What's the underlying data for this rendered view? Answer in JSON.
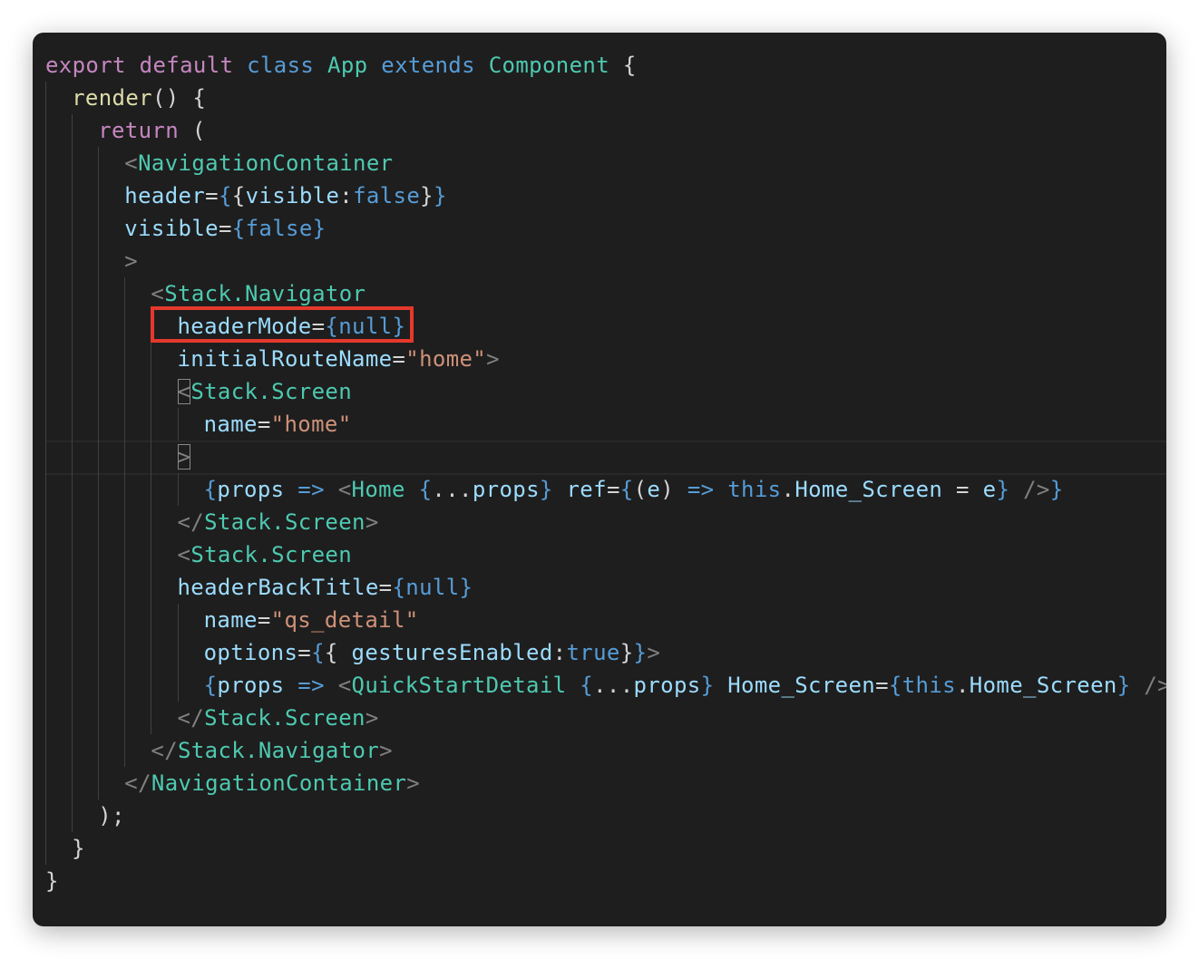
{
  "editor": {
    "theme_colors": {
      "background": "#1e1e1e",
      "keyword": "#c586c0",
      "storage": "#569cd6",
      "class": "#4ec9b0",
      "function": "#dcdcaa",
      "attribute": "#9cdcfe",
      "string": "#ce9178",
      "highlight_box": "#e5382c"
    },
    "highlighted_text": "headerMode={null}",
    "lines": [
      {
        "indent": 0,
        "tokens": [
          [
            "kw",
            "export"
          ],
          [
            "pun",
            " "
          ],
          [
            "kw",
            "default"
          ],
          [
            "pun",
            " "
          ],
          [
            "st",
            "class"
          ],
          [
            "pun",
            " "
          ],
          [
            "cls",
            "App"
          ],
          [
            "pun",
            " "
          ],
          [
            "st",
            "extends"
          ],
          [
            "pun",
            " "
          ],
          [
            "cls",
            "Component"
          ],
          [
            "pun",
            " {"
          ]
        ]
      },
      {
        "indent": 1,
        "tokens": [
          [
            "fn",
            "render"
          ],
          [
            "pun",
            "() {"
          ]
        ]
      },
      {
        "indent": 2,
        "tokens": [
          [
            "kw",
            "return"
          ],
          [
            "pun",
            " ("
          ]
        ]
      },
      {
        "indent": 3,
        "tokens": [
          [
            "br",
            "<"
          ],
          [
            "tag",
            "NavigationContainer"
          ]
        ]
      },
      {
        "indent": 3,
        "tokens": [
          [
            "att",
            "header"
          ],
          [
            "pun",
            "="
          ],
          [
            "st",
            "{"
          ],
          [
            "pun",
            "{"
          ],
          [
            "att",
            "visible"
          ],
          [
            "pun",
            ":"
          ],
          [
            "st",
            "false"
          ],
          [
            "pun",
            "}"
          ],
          [
            "st",
            "}"
          ]
        ]
      },
      {
        "indent": 3,
        "tokens": [
          [
            "att",
            "visible"
          ],
          [
            "pun",
            "="
          ],
          [
            "st",
            "{false}"
          ]
        ]
      },
      {
        "indent": 3,
        "tokens": [
          [
            "br",
            ">"
          ]
        ]
      },
      {
        "indent": 4,
        "tokens": [
          [
            "br",
            "<"
          ],
          [
            "tag",
            "Stack.Navigator"
          ]
        ]
      },
      {
        "indent": 5,
        "tokens": [
          [
            "att",
            "headerMode"
          ],
          [
            "pun",
            "="
          ],
          [
            "st",
            "{null}"
          ]
        ]
      },
      {
        "indent": 5,
        "tokens": [
          [
            "att",
            "initialRouteName"
          ],
          [
            "pun",
            "="
          ],
          [
            "str",
            "\"home\""
          ],
          [
            "br",
            ">"
          ]
        ]
      },
      {
        "indent": 5,
        "tokens": [
          [
            "br",
            "<",
            "match"
          ],
          [
            "tag",
            "Stack.Screen"
          ]
        ]
      },
      {
        "indent": 6,
        "tokens": [
          [
            "att",
            "name"
          ],
          [
            "pun",
            "="
          ],
          [
            "str",
            "\"home\""
          ]
        ]
      },
      {
        "indent": 5,
        "tokens": [
          [
            "br",
            ">",
            "match"
          ]
        ]
      },
      {
        "indent": 6,
        "tokens": [
          [
            "st",
            "{"
          ],
          [
            "att",
            "props"
          ],
          [
            "pun",
            " "
          ],
          [
            "st",
            "=>"
          ],
          [
            "pun",
            " "
          ],
          [
            "br",
            "<"
          ],
          [
            "tag",
            "Home"
          ],
          [
            "pun",
            " "
          ],
          [
            "st",
            "{"
          ],
          [
            "pun",
            "..."
          ],
          [
            "att",
            "props"
          ],
          [
            "st",
            "}"
          ],
          [
            "pun",
            " "
          ],
          [
            "att",
            "ref"
          ],
          [
            "pun",
            "="
          ],
          [
            "st",
            "{"
          ],
          [
            "pun",
            "("
          ],
          [
            "att",
            "e"
          ],
          [
            "pun",
            ") "
          ],
          [
            "st",
            "=>"
          ],
          [
            "pun",
            " "
          ],
          [
            "st",
            "this"
          ],
          [
            "pun",
            "."
          ],
          [
            "att",
            "Home_Screen"
          ],
          [
            "pun",
            " = "
          ],
          [
            "att",
            "e"
          ],
          [
            "st",
            "}"
          ],
          [
            "pun",
            " "
          ],
          [
            "br",
            "/>"
          ],
          [
            "st",
            "}"
          ]
        ]
      },
      {
        "indent": 5,
        "tokens": [
          [
            "br",
            "</"
          ],
          [
            "tag",
            "Stack.Screen"
          ],
          [
            "br",
            ">"
          ]
        ]
      },
      {
        "indent": 5,
        "tokens": [
          [
            "br",
            "<"
          ],
          [
            "tag",
            "Stack.Screen"
          ]
        ]
      },
      {
        "indent": 5,
        "tokens": [
          [
            "att",
            "headerBackTitle"
          ],
          [
            "pun",
            "="
          ],
          [
            "st",
            "{null}"
          ]
        ]
      },
      {
        "indent": 6,
        "tokens": [
          [
            "att",
            "name"
          ],
          [
            "pun",
            "="
          ],
          [
            "str",
            "\"qs_detail\""
          ]
        ]
      },
      {
        "indent": 6,
        "tokens": [
          [
            "att",
            "options"
          ],
          [
            "pun",
            "="
          ],
          [
            "st",
            "{"
          ],
          [
            "pun",
            "{ "
          ],
          [
            "att",
            "gesturesEnabled"
          ],
          [
            "pun",
            ":"
          ],
          [
            "st",
            "true"
          ],
          [
            "pun",
            "}"
          ],
          [
            "st",
            "}"
          ],
          [
            "br",
            ">"
          ]
        ]
      },
      {
        "indent": 6,
        "tokens": [
          [
            "st",
            "{"
          ],
          [
            "att",
            "props"
          ],
          [
            "pun",
            " "
          ],
          [
            "st",
            "=>"
          ],
          [
            "pun",
            " "
          ],
          [
            "br",
            "<"
          ],
          [
            "tag",
            "QuickStartDetail"
          ],
          [
            "pun",
            " "
          ],
          [
            "st",
            "{"
          ],
          [
            "pun",
            "..."
          ],
          [
            "att",
            "props"
          ],
          [
            "st",
            "}"
          ],
          [
            "pun",
            " "
          ],
          [
            "att",
            "Home_Screen"
          ],
          [
            "pun",
            "="
          ],
          [
            "st",
            "{this"
          ],
          [
            "pun",
            "."
          ],
          [
            "att",
            "Home_Screen"
          ],
          [
            "st",
            "}"
          ],
          [
            "pun",
            " "
          ],
          [
            "br",
            "/>"
          ],
          [
            "st",
            "}"
          ]
        ]
      },
      {
        "indent": 5,
        "tokens": [
          [
            "br",
            "</"
          ],
          [
            "tag",
            "Stack.Screen"
          ],
          [
            "br",
            ">"
          ]
        ]
      },
      {
        "indent": 4,
        "tokens": [
          [
            "br",
            "</"
          ],
          [
            "tag",
            "Stack.Navigator"
          ],
          [
            "br",
            ">"
          ]
        ]
      },
      {
        "indent": 3,
        "tokens": [
          [
            "br",
            "</"
          ],
          [
            "tag",
            "NavigationContainer"
          ],
          [
            "br",
            ">"
          ]
        ]
      },
      {
        "indent": 2,
        "tokens": [
          [
            "pun",
            ");"
          ]
        ]
      },
      {
        "indent": 1,
        "tokens": [
          [
            "pun",
            "}"
          ]
        ]
      },
      {
        "indent": 0,
        "tokens": [
          [
            "pun",
            "}"
          ]
        ]
      }
    ]
  }
}
